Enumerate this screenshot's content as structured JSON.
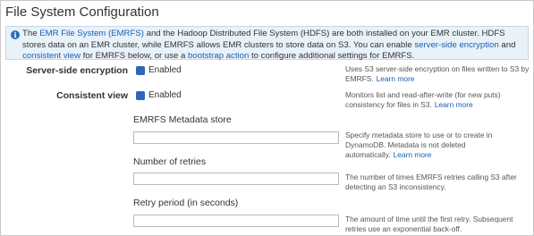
{
  "title": "File System Configuration",
  "info": {
    "text_1": "The ",
    "link_emrfs": "EMR File System (EMRFS)",
    "text_2": " and the Hadoop Distributed File System (HDFS) are both installed on your EMR cluster. HDFS stores data on an EMR cluster, while EMRFS allows EMR clusters to store data on S3. You can enable ",
    "link_sse": "server-side encryption",
    "text_3": " and ",
    "link_consistent": "consistent view",
    "text_4": " for EMRFS below, or use a ",
    "link_bootstrap": "bootstrap action",
    "text_5": " to configure additional settings for EMRFS."
  },
  "sse": {
    "label": "Server-side encryption",
    "checkbox_label": "Enabled",
    "help": "Uses S3 server-side encryption on files written to S3 by EMRFS.",
    "learn_more": "Learn more"
  },
  "consistent_view": {
    "label": "Consistent view",
    "checkbox_label": "Enabled",
    "help": "Monitors list and read-after-write (for new puts) consistency for files in S3.",
    "learn_more": "Learn more"
  },
  "metadata_store": {
    "label": "EMRFS Metadata store",
    "value": "",
    "help": "Specify metadata store to use or to create in DynamoDB. Metadata is not deleted automatically.",
    "learn_more": "Learn more"
  },
  "retries": {
    "label": "Number of retries",
    "value": "",
    "help": "The number of times EMRFS retries calling S3 after detecting an S3 inconsistency."
  },
  "retry_period": {
    "label": "Retry period (in seconds)",
    "value": "",
    "help": "The amount of time until the first retry. Subsequent retries use an exponential back-off."
  }
}
